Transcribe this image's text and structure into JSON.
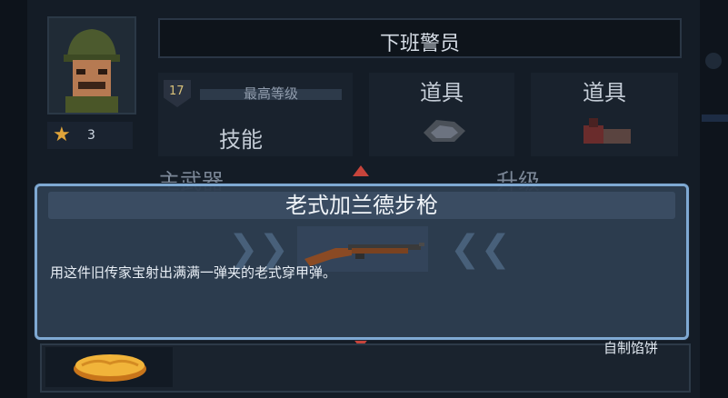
{
  "character": {
    "name": "下班警员",
    "stars": "3"
  },
  "rank": {
    "level": "17",
    "label": "最高等级"
  },
  "slots": {
    "skill_label": "技能",
    "item1_label": "道具",
    "item2_label": "道具"
  },
  "tabs": {
    "primary": "主武器",
    "upgrade": "升级"
  },
  "popup": {
    "title": "老式加兰德步枪",
    "description": "用这件旧传家宝射出满满一弹夹的老式穿甲弹。"
  },
  "bottom": {
    "label": "自制馅饼"
  },
  "colors": {
    "popup_border": "#7fa9d3",
    "star": "#e0a43a",
    "arrow": "#c7443b"
  }
}
